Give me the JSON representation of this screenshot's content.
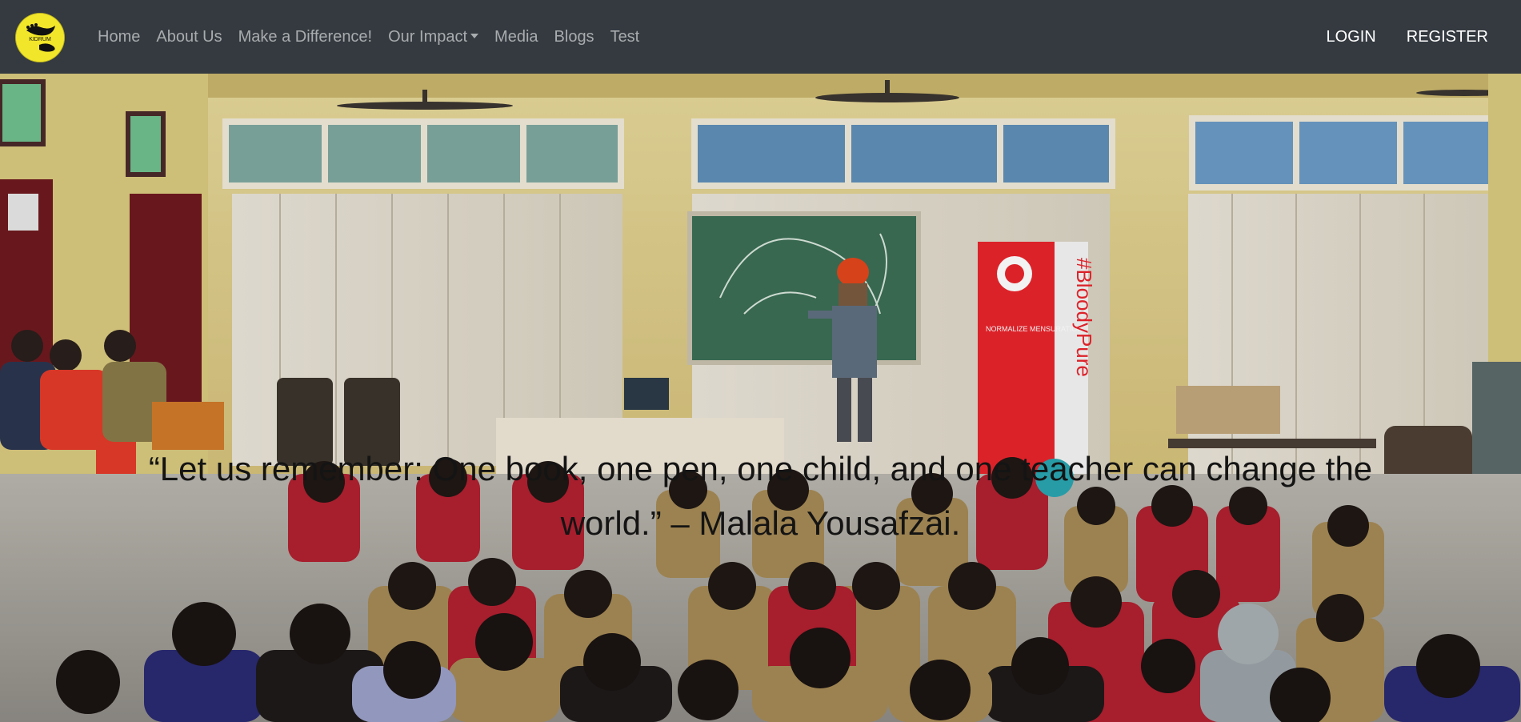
{
  "nav": {
    "logo_text": "KIDRUM",
    "links": [
      {
        "label": "Home"
      },
      {
        "label": "About Us"
      },
      {
        "label": "Make a Difference!"
      },
      {
        "label": "Our Impact"
      },
      {
        "label": "Media"
      },
      {
        "label": "Blogs"
      },
      {
        "label": "Test"
      }
    ],
    "login": "LOGIN",
    "register": "REGISTER"
  },
  "hero": {
    "quote": "“Let us remember: One book, one pen, one child, and one teacher can change the world.” – Malala Yousafzai.",
    "banner_text": "#BloodyPure",
    "banner_sub": "NORMALIZE MENSURATION"
  },
  "colors": {
    "navbar": "#343a40",
    "nav_link": "#a9acae",
    "logo": "#f2e62a",
    "banner": "#e8242c"
  }
}
